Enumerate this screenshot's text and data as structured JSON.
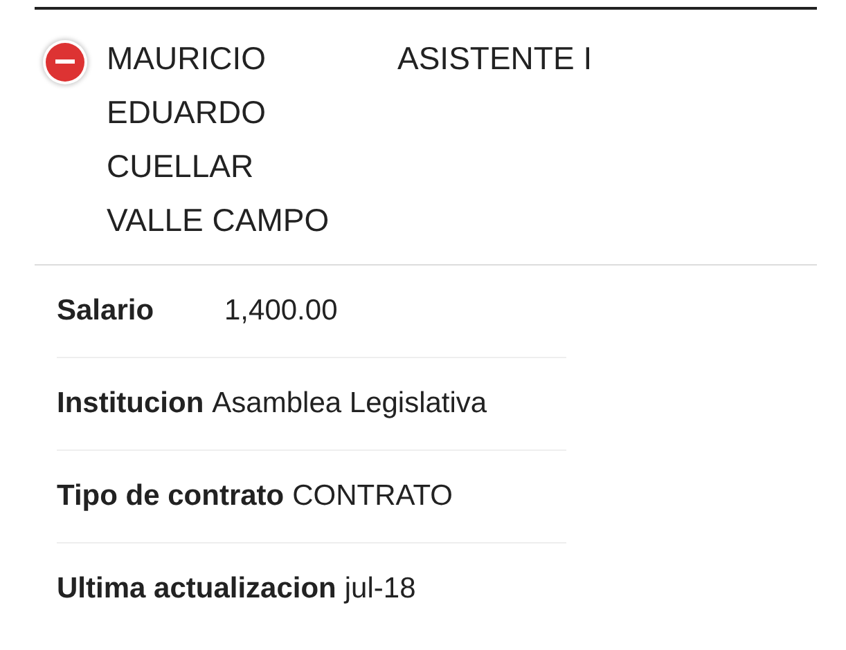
{
  "record": {
    "expanded": true,
    "name": "MAURICIO EDUARDO CUELLAR VALLE CAMPO",
    "position": "ASISTENTE I",
    "details": [
      {
        "label": "Salario",
        "value": "1,400.00"
      },
      {
        "label": "Institucion",
        "value": "Asamblea Legislativa"
      },
      {
        "label": "Tipo de contrato",
        "value": "CONTRATO"
      },
      {
        "label": "Ultima actualizacion",
        "value": "jul-18"
      }
    ]
  }
}
